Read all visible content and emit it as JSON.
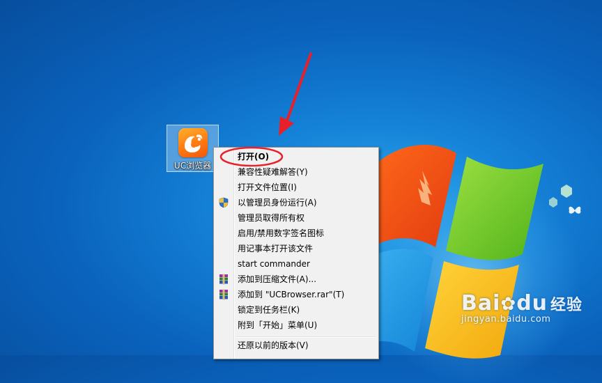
{
  "desktop": {
    "icon_label": "UC浏览器"
  },
  "context_menu": {
    "items": [
      {
        "label": "打开(O)",
        "bold": true,
        "icon": ""
      },
      {
        "label": "兼容性疑难解答(Y)",
        "icon": ""
      },
      {
        "label": "打开文件位置(I)",
        "icon": ""
      },
      {
        "label": "以管理员身份运行(A)",
        "icon": "uac-shield-icon"
      },
      {
        "label": "管理员取得所有权",
        "icon": ""
      },
      {
        "label": "启用/禁用数字签名图标",
        "icon": ""
      },
      {
        "label": "用记事本打开该文件",
        "icon": ""
      },
      {
        "label": "start commander",
        "icon": ""
      },
      {
        "label": "添加到压缩文件(A)...",
        "icon": "winrar-icon"
      },
      {
        "label": "添加到 \"UCBrowser.rar\"(T)",
        "icon": "winrar-icon"
      },
      {
        "label": "锁定到任务栏(K)",
        "icon": ""
      },
      {
        "label": "附到「开始」菜单(U)",
        "icon": ""
      },
      {
        "label": "还原以前的版本(V)",
        "icon": ""
      }
    ]
  },
  "watermark": {
    "brand_latin": "Bai",
    "brand_paw": "du",
    "brand_cn": "经验",
    "url": "jingyan.baidu.com"
  },
  "annotation_color": "#e8202a"
}
